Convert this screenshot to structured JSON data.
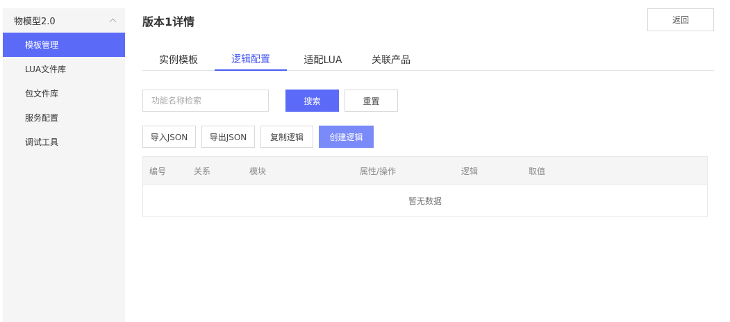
{
  "sidebar": {
    "group_label": "物模型2.0",
    "items": [
      {
        "label": "模板管理",
        "active": true
      },
      {
        "label": "LUA文件库",
        "active": false
      },
      {
        "label": "包文件库",
        "active": false
      },
      {
        "label": "服务配置",
        "active": false
      },
      {
        "label": "调试工具",
        "active": false
      }
    ]
  },
  "header": {
    "title": "版本1详情",
    "back_label": "返回"
  },
  "tabs": [
    {
      "label": "实例模板",
      "active": false
    },
    {
      "label": "逻辑配置",
      "active": true
    },
    {
      "label": "适配LUA",
      "active": false
    },
    {
      "label": "关联产品",
      "active": false
    }
  ],
  "search": {
    "placeholder": "功能名称检索",
    "value": "",
    "search_label": "搜索",
    "reset_label": "重置"
  },
  "actions": {
    "import_label": "导入JSON",
    "export_label": "导出JSON",
    "copy_label": "复制逻辑",
    "create_label": "创建逻辑"
  },
  "table": {
    "columns": [
      "编号",
      "关系",
      "模块",
      "属性/操作",
      "逻辑",
      "取值"
    ],
    "empty_text": "暂无数据"
  },
  "colors": {
    "accent": "#5b6bf8",
    "accent_light": "#7b8af9",
    "tab_active": "#4a5cf0"
  }
}
